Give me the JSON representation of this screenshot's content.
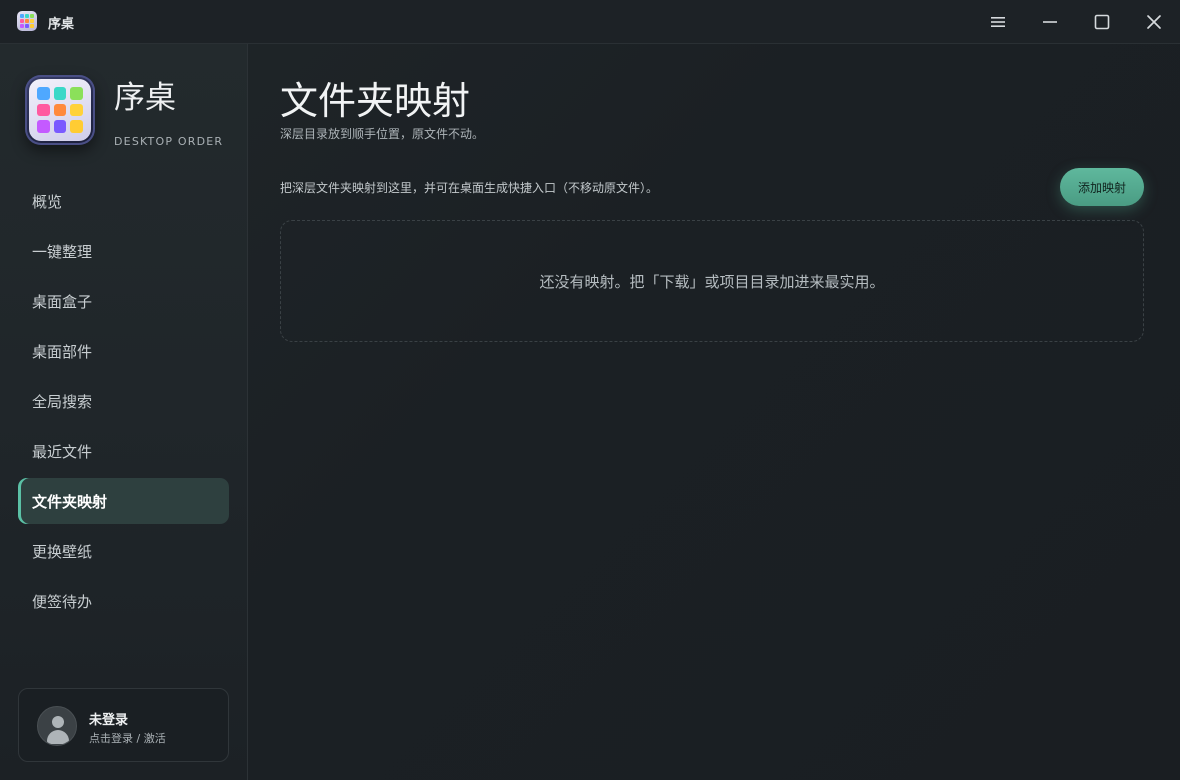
{
  "window": {
    "title": "序桌",
    "controls": [
      {
        "name": "menu-icon",
        "glyph": "≡"
      },
      {
        "name": "minimize-icon"
      },
      {
        "name": "maximize-icon"
      },
      {
        "name": "close-icon"
      }
    ]
  },
  "brand": {
    "name": "序桌",
    "subtitle": "DESKTOP ORDER",
    "icon_colors": [
      "#4fa8ff",
      "#3ad8c8",
      "#8be05a",
      "#ff5aa0",
      "#ff8a3d",
      "#ffd23a",
      "#c45aff",
      "#7a5aff",
      "#ffcc33"
    ]
  },
  "sidebar": {
    "items": [
      {
        "label": "概览",
        "active": false
      },
      {
        "label": "一键整理",
        "active": false
      },
      {
        "label": "桌面盒子",
        "active": false
      },
      {
        "label": "桌面部件",
        "active": false
      },
      {
        "label": "全局搜索",
        "active": false
      },
      {
        "label": "最近文件",
        "active": false
      },
      {
        "label": "文件夹映射",
        "active": true
      },
      {
        "label": "更换壁纸",
        "active": false
      },
      {
        "label": "便签待办",
        "active": false
      }
    ]
  },
  "user": {
    "name": "未登录",
    "action": "点击登录 / 激活"
  },
  "main": {
    "title": "文件夹映射",
    "subtitle": "深层目录放到顺手位置，原文件不动。",
    "description": "把深层文件夹映射到这里，并可在桌面生成快捷入口（不移动原文件）。",
    "add_button": "添加映射",
    "empty_message": "还没有映射。把「下载」或项目目录加进来最实用。"
  },
  "colors": {
    "accent": "#5bc1a6",
    "active_bg": "#2e403f",
    "button": "#55aa90"
  }
}
